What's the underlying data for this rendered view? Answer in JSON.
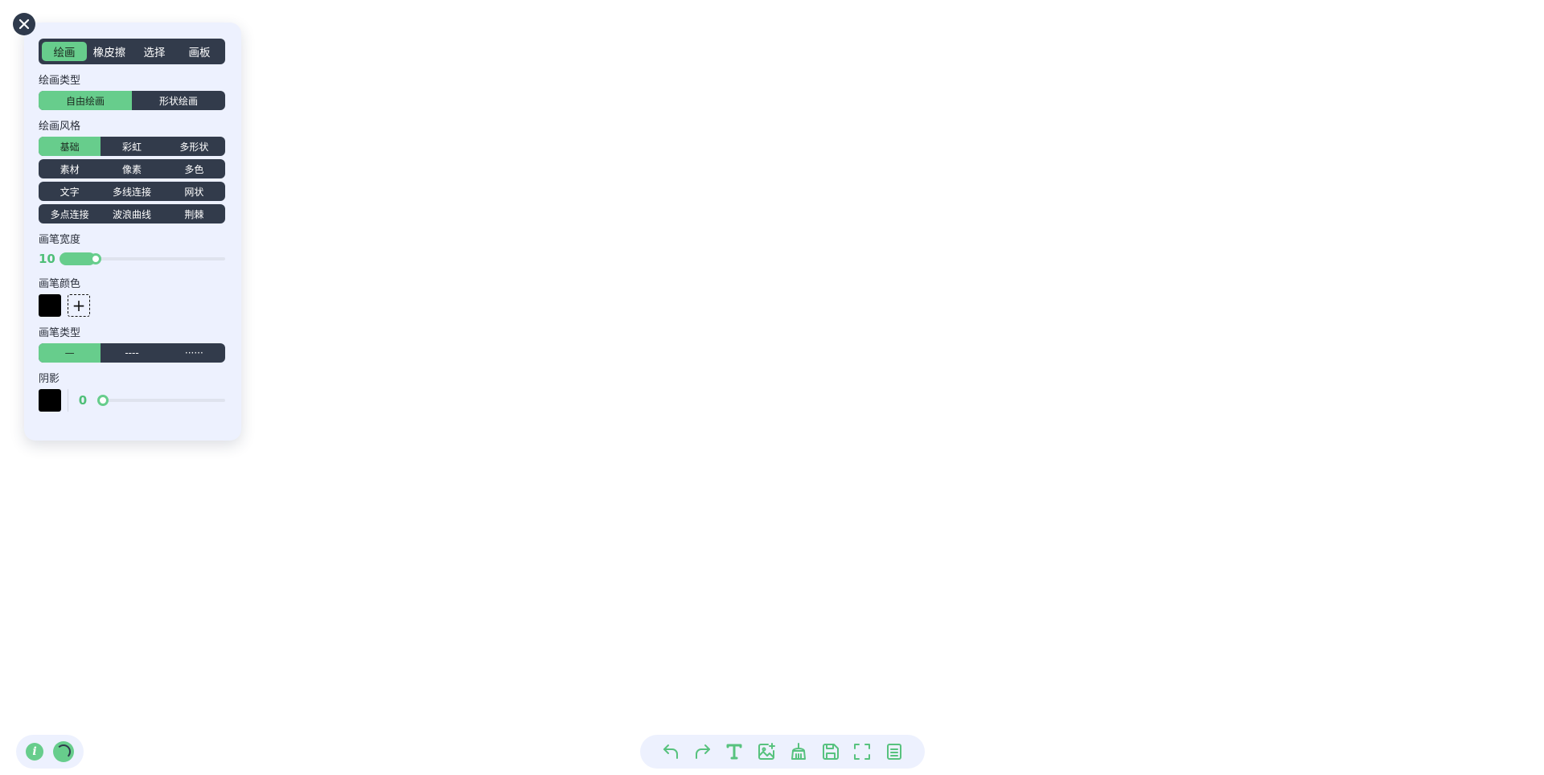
{
  "tabs": [
    {
      "label": "绘画",
      "active": true
    },
    {
      "label": "橡皮擦",
      "active": false
    },
    {
      "label": "选择",
      "active": false
    },
    {
      "label": "画板",
      "active": false
    }
  ],
  "draw_type": {
    "label": "绘画类型",
    "options": [
      {
        "label": "自由绘画",
        "active": true
      },
      {
        "label": "形状绘画",
        "active": false
      }
    ]
  },
  "draw_style": {
    "label": "绘画风格",
    "rows": [
      [
        {
          "label": "基础",
          "active": true
        },
        {
          "label": "彩虹",
          "active": false
        },
        {
          "label": "多形状",
          "active": false
        }
      ],
      [
        {
          "label": "素材",
          "active": false
        },
        {
          "label": "像素",
          "active": false
        },
        {
          "label": "多色",
          "active": false
        }
      ],
      [
        {
          "label": "文字",
          "active": false
        },
        {
          "label": "多线连接",
          "active": false
        },
        {
          "label": "网状",
          "active": false
        }
      ],
      [
        {
          "label": "多点连接",
          "active": false
        },
        {
          "label": "波浪曲线",
          "active": false
        },
        {
          "label": "荆棘",
          "active": false
        }
      ]
    ]
  },
  "brush_width": {
    "label": "画笔宽度",
    "value": "10",
    "fraction": 0.22
  },
  "brush_color": {
    "label": "画笔颜色",
    "color": "#000000",
    "add_symbol": "+"
  },
  "line_type": {
    "label": "画笔类型",
    "options": [
      {
        "label": "—",
        "active": true
      },
      {
        "label": "----",
        "active": false
      },
      {
        "label": "······",
        "active": false
      }
    ]
  },
  "shadow": {
    "label": "阴影",
    "color": "#000000",
    "value": "0",
    "fraction": 0
  },
  "bottom_left": {
    "info_symbol": "i",
    "icons": [
      "info-icon",
      "theme-toggle-icon"
    ]
  },
  "toolbar_icons": [
    "undo-icon",
    "redo-icon",
    "text-icon",
    "image-add-icon",
    "clean-icon",
    "save-icon",
    "fullscreen-icon",
    "layers-icon"
  ],
  "colors": {
    "accent": "#67cd8c",
    "dark": "#323b4b",
    "panel": "#edf1fe"
  }
}
